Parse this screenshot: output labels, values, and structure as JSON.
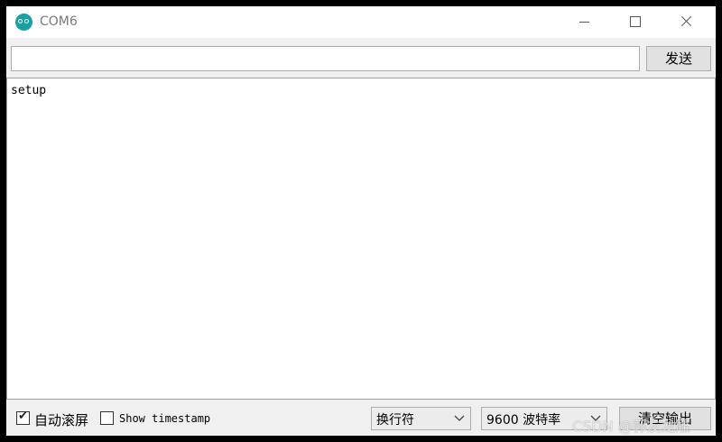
{
  "window": {
    "title": "COM6",
    "app_icon": "arduino-logo-icon",
    "controls": [
      "minimize-icon",
      "maximize-icon",
      "close-icon"
    ]
  },
  "send_bar": {
    "input_value": "",
    "send_label": "发送"
  },
  "output": {
    "lines": [
      "setup"
    ]
  },
  "footer": {
    "autoscroll_label": "自动滚屏",
    "autoscroll_checked": true,
    "timestamp_label": "Show timestamp",
    "timestamp_checked": false,
    "line_ending_value": "换行符",
    "baud_value": "9600 波特率",
    "clear_label": "清空输出"
  },
  "watermark": "CSDN @郭友龙雕",
  "colors": {
    "accent": "#17a1a5"
  }
}
